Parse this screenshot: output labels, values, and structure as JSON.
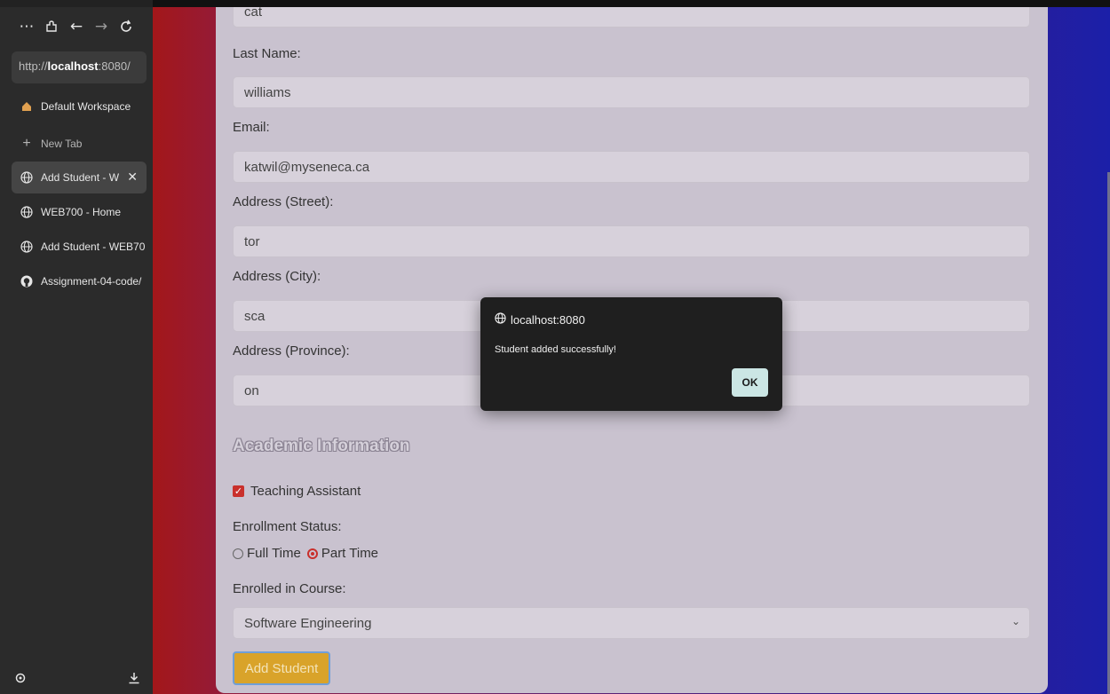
{
  "browser": {
    "url_prefix": "http://",
    "url_host": "localhost",
    "url_rest": ":8080/",
    "workspace": "Default Workspace",
    "new_tab": "New Tab",
    "tabs": [
      {
        "title": "Add Student - W",
        "active": true
      },
      {
        "title": "WEB700 - Home",
        "active": false
      },
      {
        "title": "Add Student - WEB70",
        "active": false
      },
      {
        "title": "Assignment-04-code/",
        "active": false
      }
    ]
  },
  "form": {
    "partial_top_value": "cat",
    "last_name_label": "Last Name:",
    "last_name_value": "williams",
    "email_label": "Email:",
    "email_value": "katwil@myseneca.ca",
    "street_label": "Address (Street):",
    "street_value": "tor",
    "city_label": "Address (City):",
    "city_value": "sca",
    "province_label": "Address (Province):",
    "province_value": "on",
    "academic_heading": "Academic Information",
    "ta_label": "Teaching Assistant",
    "ta_checked": true,
    "enrollment_label": "Enrollment Status:",
    "full_time_label": "Full Time",
    "part_time_label": "Part Time",
    "enrollment_selected": "Part Time",
    "course_label": "Enrolled in Course:",
    "course_value": "Software Engineering",
    "submit_label": "Add Student"
  },
  "dialog": {
    "origin": "localhost:8080",
    "message": "Student added successfully!",
    "ok_label": "OK"
  },
  "colors": {
    "accent_red": "#c9302c",
    "submit_button": "#d9a32a",
    "dialog_bg": "#1f1f1f",
    "ok_button": "#cbe6e4"
  }
}
